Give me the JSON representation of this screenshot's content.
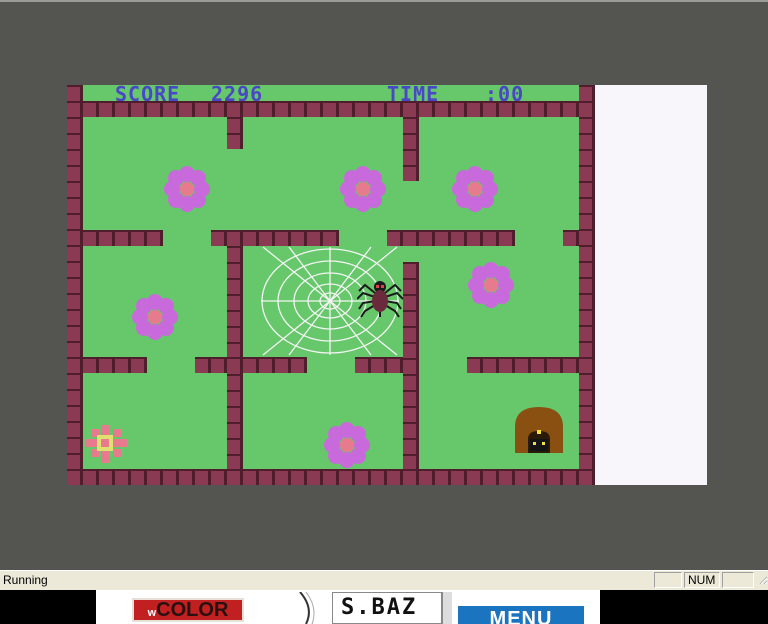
{
  "hud": {
    "score_label": "SCORE",
    "score_value": "2296",
    "time_label": "TIME",
    "time_value": ":00",
    "text_color": "#4a46c8"
  },
  "game": {
    "grass_color": "#66c86a",
    "wall_color": "#8a3a52",
    "flower_petal_color": "#c86adc",
    "flower_center_color": "#e87a8e",
    "player": "pink-flower-bug",
    "enemy": "spider",
    "web": "spider-web",
    "home": "mouse-hole"
  },
  "statusbar": {
    "status": "Running",
    "num_indicator": "NUM"
  },
  "taskbar": {
    "color_button": "COLOR",
    "color_button_prefix": "w",
    "field_value": "S.BAZ",
    "menu_button": "MENU"
  }
}
